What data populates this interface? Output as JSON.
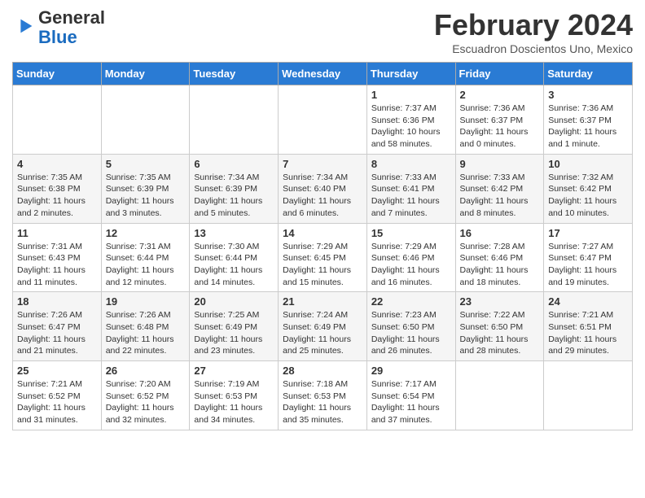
{
  "header": {
    "logo_line1": "General",
    "logo_line2": "Blue",
    "month_title": "February 2024",
    "subtitle": "Escuadron Doscientos Uno, Mexico"
  },
  "days_of_week": [
    "Sunday",
    "Monday",
    "Tuesday",
    "Wednesday",
    "Thursday",
    "Friday",
    "Saturday"
  ],
  "weeks": [
    [
      {
        "day": "",
        "info": ""
      },
      {
        "day": "",
        "info": ""
      },
      {
        "day": "",
        "info": ""
      },
      {
        "day": "",
        "info": ""
      },
      {
        "day": "1",
        "info": "Sunrise: 7:37 AM\nSunset: 6:36 PM\nDaylight: 10 hours\nand 58 minutes."
      },
      {
        "day": "2",
        "info": "Sunrise: 7:36 AM\nSunset: 6:37 PM\nDaylight: 11 hours\nand 0 minutes."
      },
      {
        "day": "3",
        "info": "Sunrise: 7:36 AM\nSunset: 6:37 PM\nDaylight: 11 hours\nand 1 minute."
      }
    ],
    [
      {
        "day": "4",
        "info": "Sunrise: 7:35 AM\nSunset: 6:38 PM\nDaylight: 11 hours\nand 2 minutes."
      },
      {
        "day": "5",
        "info": "Sunrise: 7:35 AM\nSunset: 6:39 PM\nDaylight: 11 hours\nand 3 minutes."
      },
      {
        "day": "6",
        "info": "Sunrise: 7:34 AM\nSunset: 6:39 PM\nDaylight: 11 hours\nand 5 minutes."
      },
      {
        "day": "7",
        "info": "Sunrise: 7:34 AM\nSunset: 6:40 PM\nDaylight: 11 hours\nand 6 minutes."
      },
      {
        "day": "8",
        "info": "Sunrise: 7:33 AM\nSunset: 6:41 PM\nDaylight: 11 hours\nand 7 minutes."
      },
      {
        "day": "9",
        "info": "Sunrise: 7:33 AM\nSunset: 6:42 PM\nDaylight: 11 hours\nand 8 minutes."
      },
      {
        "day": "10",
        "info": "Sunrise: 7:32 AM\nSunset: 6:42 PM\nDaylight: 11 hours\nand 10 minutes."
      }
    ],
    [
      {
        "day": "11",
        "info": "Sunrise: 7:31 AM\nSunset: 6:43 PM\nDaylight: 11 hours\nand 11 minutes."
      },
      {
        "day": "12",
        "info": "Sunrise: 7:31 AM\nSunset: 6:44 PM\nDaylight: 11 hours\nand 12 minutes."
      },
      {
        "day": "13",
        "info": "Sunrise: 7:30 AM\nSunset: 6:44 PM\nDaylight: 11 hours\nand 14 minutes."
      },
      {
        "day": "14",
        "info": "Sunrise: 7:29 AM\nSunset: 6:45 PM\nDaylight: 11 hours\nand 15 minutes."
      },
      {
        "day": "15",
        "info": "Sunrise: 7:29 AM\nSunset: 6:46 PM\nDaylight: 11 hours\nand 16 minutes."
      },
      {
        "day": "16",
        "info": "Sunrise: 7:28 AM\nSunset: 6:46 PM\nDaylight: 11 hours\nand 18 minutes."
      },
      {
        "day": "17",
        "info": "Sunrise: 7:27 AM\nSunset: 6:47 PM\nDaylight: 11 hours\nand 19 minutes."
      }
    ],
    [
      {
        "day": "18",
        "info": "Sunrise: 7:26 AM\nSunset: 6:47 PM\nDaylight: 11 hours\nand 21 minutes."
      },
      {
        "day": "19",
        "info": "Sunrise: 7:26 AM\nSunset: 6:48 PM\nDaylight: 11 hours\nand 22 minutes."
      },
      {
        "day": "20",
        "info": "Sunrise: 7:25 AM\nSunset: 6:49 PM\nDaylight: 11 hours\nand 23 minutes."
      },
      {
        "day": "21",
        "info": "Sunrise: 7:24 AM\nSunset: 6:49 PM\nDaylight: 11 hours\nand 25 minutes."
      },
      {
        "day": "22",
        "info": "Sunrise: 7:23 AM\nSunset: 6:50 PM\nDaylight: 11 hours\nand 26 minutes."
      },
      {
        "day": "23",
        "info": "Sunrise: 7:22 AM\nSunset: 6:50 PM\nDaylight: 11 hours\nand 28 minutes."
      },
      {
        "day": "24",
        "info": "Sunrise: 7:21 AM\nSunset: 6:51 PM\nDaylight: 11 hours\nand 29 minutes."
      }
    ],
    [
      {
        "day": "25",
        "info": "Sunrise: 7:21 AM\nSunset: 6:52 PM\nDaylight: 11 hours\nand 31 minutes."
      },
      {
        "day": "26",
        "info": "Sunrise: 7:20 AM\nSunset: 6:52 PM\nDaylight: 11 hours\nand 32 minutes."
      },
      {
        "day": "27",
        "info": "Sunrise: 7:19 AM\nSunset: 6:53 PM\nDaylight: 11 hours\nand 34 minutes."
      },
      {
        "day": "28",
        "info": "Sunrise: 7:18 AM\nSunset: 6:53 PM\nDaylight: 11 hours\nand 35 minutes."
      },
      {
        "day": "29",
        "info": "Sunrise: 7:17 AM\nSunset: 6:54 PM\nDaylight: 11 hours\nand 37 minutes."
      },
      {
        "day": "",
        "info": ""
      },
      {
        "day": "",
        "info": ""
      }
    ]
  ]
}
